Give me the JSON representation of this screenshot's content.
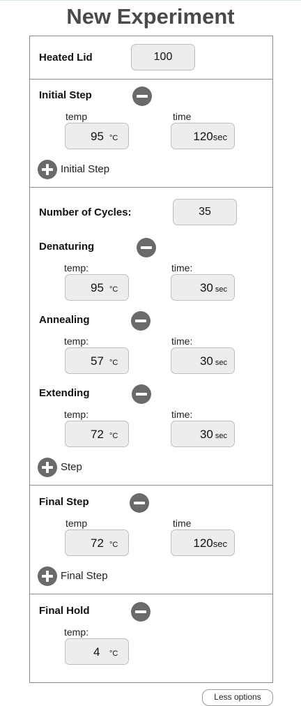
{
  "title": "New Experiment",
  "heated_lid": {
    "label": "Heated Lid",
    "value": "100"
  },
  "initial_step": {
    "label": "Initial Step",
    "temp_label": "temp",
    "time_label": "time",
    "temp": "95",
    "temp_unit": "°C",
    "time": "120",
    "time_unit": "sec",
    "add_label": "Initial Step"
  },
  "cycles": {
    "label": "Number of Cycles:",
    "value": "35"
  },
  "steps": [
    {
      "label": "Denaturing",
      "temp_label": "temp:",
      "time_label": "time:",
      "temp": "95",
      "temp_unit": "°C",
      "time": "30",
      "time_unit": "sec"
    },
    {
      "label": "Annealing",
      "temp_label": "temp:",
      "time_label": "time:",
      "temp": "57",
      "temp_unit": "°C",
      "time": "30",
      "time_unit": "sec"
    },
    {
      "label": "Extending",
      "temp_label": "temp:",
      "time_label": "time:",
      "temp": "72",
      "temp_unit": "°C",
      "time": "30",
      "time_unit": "sec"
    }
  ],
  "add_step_label": "Step",
  "final_step": {
    "label": "Final Step",
    "temp_label": "temp",
    "time_label": "time",
    "temp": "72",
    "temp_unit": "°C",
    "time": "120",
    "time_unit": "sec",
    "add_label": "Final Step"
  },
  "final_hold": {
    "label": "Final Hold",
    "temp_label": "temp:",
    "temp": "4",
    "temp_unit": "°C"
  },
  "less_options_label": "Less options",
  "icons": {
    "remove": "minus-circle-icon",
    "add": "plus-circle-icon"
  }
}
